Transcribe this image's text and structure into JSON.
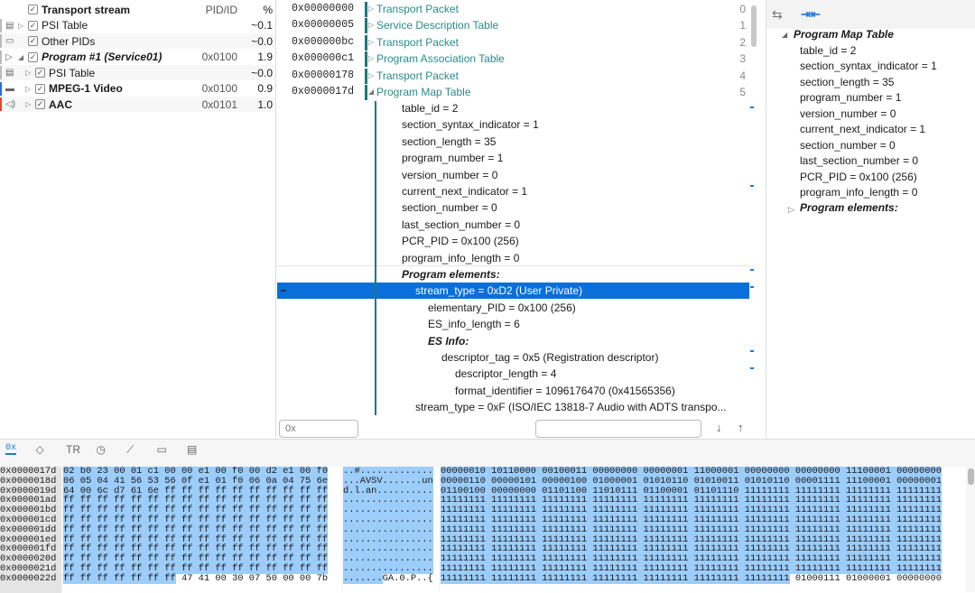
{
  "streams": {
    "header": {
      "label": "Transport stream",
      "pid_col": "PID/ID",
      "pct_col": "%"
    },
    "rows": [
      {
        "label": "PSI Table",
        "pid": "",
        "pct": "~0.1",
        "icon": "table-icon",
        "bold": false,
        "italic": false
      },
      {
        "label": "Other PIDs",
        "pid": "",
        "pct": "~0.0",
        "icon": "other-icon",
        "bold": false,
        "italic": false
      },
      {
        "label": "Program #1 (Service01)",
        "pid": "0x0100",
        "pct": "1.9",
        "icon": "program-icon",
        "bold": true,
        "italic": true
      },
      {
        "label": "PSI Table",
        "pid": "",
        "pct": "~0.0",
        "icon": "table-icon",
        "bold": false,
        "italic": false
      },
      {
        "label": "MPEG-1 Video",
        "pid": "0x0100",
        "pct": "0.9",
        "icon": "video-icon",
        "bold": true,
        "italic": false,
        "color": "#2a6be0"
      },
      {
        "label": "AAC",
        "pid": "0x0101",
        "pct": "1.0",
        "icon": "audio-icon",
        "bold": true,
        "italic": false,
        "color": "#e8452c"
      }
    ]
  },
  "packets": [
    {
      "addr": "0x00000000",
      "label": "Transport Packet",
      "index": "0"
    },
    {
      "addr": "0x00000005",
      "label": "Service Description Table",
      "index": "1"
    },
    {
      "addr": "0x000000bc",
      "label": "Transport Packet",
      "index": "2"
    },
    {
      "addr": "0x000000c1",
      "label": "Program Association Table",
      "index": "3"
    },
    {
      "addr": "0x00000178",
      "label": "Transport Packet",
      "index": "4"
    },
    {
      "addr": "0x0000017d",
      "label": "Program Map Table",
      "index": "5"
    }
  ],
  "pmt_fields": [
    {
      "text": "table_id = 2",
      "level": 0
    },
    {
      "text": "section_syntax_indicator = 1",
      "level": 0
    },
    {
      "text": "section_length = 35",
      "level": 0
    },
    {
      "text": "program_number = 1",
      "level": 0
    },
    {
      "text": "version_number = 0",
      "level": 0
    },
    {
      "text": "current_next_indicator = 1",
      "level": 0
    },
    {
      "text": "section_number = 0",
      "level": 0
    },
    {
      "text": "last_section_number = 0",
      "level": 0
    },
    {
      "text": "PCR_PID = 0x100 (256)",
      "level": 0
    },
    {
      "text": "program_info_length = 0",
      "level": 0
    },
    {
      "text": "Program elements:",
      "level": 0,
      "heading": true
    },
    {
      "text": "stream_type = 0xD2 (User Private)",
      "level": 1,
      "selected": true
    },
    {
      "text": "elementary_PID = 0x100 (256)",
      "level": 2
    },
    {
      "text": "ES_info_length = 6",
      "level": 2
    },
    {
      "text": "ES Info:",
      "level": 2,
      "heading": true
    },
    {
      "text": "descriptor_tag = 0x5 (Registration descriptor)",
      "level": 3
    },
    {
      "text": "descriptor_length = 4",
      "level": 4
    },
    {
      "text": "format_identifier = 1096176470 (0x41565356)",
      "level": 4
    },
    {
      "text": "stream_type = 0xF (ISO/IEC 13818-7 Audio with ADTS transpo...",
      "level": 1
    }
  ],
  "search": {
    "offset_placeholder": "0x",
    "text_value": "",
    "down": "↓",
    "up": "↑"
  },
  "details": {
    "title": "Program Map Table",
    "fields": [
      "table_id  =  2",
      "section_syntax_indicator  =  1",
      "section_length  =  35",
      "program_number  =  1",
      "version_number  =  0",
      "current_next_indicator  =  1",
      "section_number  =  0",
      "last_section_number  =  0",
      "PCR_PID  =  0x100 (256)",
      "program_info_length  =  0"
    ],
    "child": "Program elements:"
  },
  "bottom_tabs": [
    "hex-icon",
    "diamond-icon",
    "text-icon",
    "clock-icon",
    "chart-icon",
    "comment-icon",
    "table-icon"
  ],
  "hex_rows": [
    {
      "addr": "0x0000017d",
      "hex_sel": "02 b0 23 00 01 c1 00 00 e1 00 f0 00 d2 e1 00 f0",
      "hex_rest": "",
      "asc_sel": "..#.............",
      "asc_rest": "",
      "bin_sel": "00000010 10110000 00100011 00000000 00000001 11000001 00000000 00000000 11100001 00000000",
      "bin_rest": ""
    },
    {
      "addr": "0x0000018d",
      "hex_sel": "06 05 04 41 56 53 56 0f e1 01 f0 06 0a 04 75 6e",
      "hex_rest": "",
      "asc_sel": "...AVSV.......un",
      "asc_rest": "",
      "bin_sel": "00000110 00000101 00000100 01000001 01010110 01010011 01010110 00001111 11100001 00000001",
      "bin_rest": ""
    },
    {
      "addr": "0x0000019d",
      "hex_sel": "64 00 6c d7 61 6e ff ff ff ff ff ff ff ff ff ff",
      "hex_rest": "",
      "asc_sel": "d.l.an..........",
      "asc_rest": "",
      "bin_sel": "01100100 00000000 01101100 11010111 01100001 01101110 11111111 11111111 11111111 11111111",
      "bin_rest": ""
    },
    {
      "addr": "0x000001ad",
      "hex_sel": "ff ff ff ff ff ff ff ff ff ff ff ff ff ff ff ff",
      "hex_rest": "",
      "asc_sel": "................",
      "asc_rest": "",
      "bin_sel": "11111111 11111111 11111111 11111111 11111111 11111111 11111111 11111111 11111111 11111111",
      "bin_rest": ""
    },
    {
      "addr": "0x000001bd",
      "hex_sel": "ff ff ff ff ff ff ff ff ff ff ff ff ff ff ff ff",
      "hex_rest": "",
      "asc_sel": "................",
      "asc_rest": "",
      "bin_sel": "11111111 11111111 11111111 11111111 11111111 11111111 11111111 11111111 11111111 11111111",
      "bin_rest": ""
    },
    {
      "addr": "0x000001cd",
      "hex_sel": "ff ff ff ff ff ff ff ff ff ff ff ff ff ff ff ff",
      "hex_rest": "",
      "asc_sel": "................",
      "asc_rest": "",
      "bin_sel": "11111111 11111111 11111111 11111111 11111111 11111111 11111111 11111111 11111111 11111111",
      "bin_rest": ""
    },
    {
      "addr": "0x000001dd",
      "hex_sel": "ff ff ff ff ff ff ff ff ff ff ff ff ff ff ff ff",
      "hex_rest": "",
      "asc_sel": "................",
      "asc_rest": "",
      "bin_sel": "11111111 11111111 11111111 11111111 11111111 11111111 11111111 11111111 11111111 11111111",
      "bin_rest": ""
    },
    {
      "addr": "0x000001ed",
      "hex_sel": "ff ff ff ff ff ff ff ff ff ff ff ff ff ff ff ff",
      "hex_rest": "",
      "asc_sel": "................",
      "asc_rest": "",
      "bin_sel": "11111111 11111111 11111111 11111111 11111111 11111111 11111111 11111111 11111111 11111111",
      "bin_rest": ""
    },
    {
      "addr": "0x000001fd",
      "hex_sel": "ff ff ff ff ff ff ff ff ff ff ff ff ff ff ff ff",
      "hex_rest": "",
      "asc_sel": "................",
      "asc_rest": "",
      "bin_sel": "11111111 11111111 11111111 11111111 11111111 11111111 11111111 11111111 11111111 11111111",
      "bin_rest": ""
    },
    {
      "addr": "0x0000020d",
      "hex_sel": "ff ff ff ff ff ff ff ff ff ff ff ff ff ff ff ff",
      "hex_rest": "",
      "asc_sel": "................",
      "asc_rest": "",
      "bin_sel": "11111111 11111111 11111111 11111111 11111111 11111111 11111111 11111111 11111111 11111111",
      "bin_rest": ""
    },
    {
      "addr": "0x0000021d",
      "hex_sel": "ff ff ff ff ff ff ff ff ff ff ff ff ff ff ff ff",
      "hex_rest": "",
      "asc_sel": "................",
      "asc_rest": "",
      "bin_sel": "11111111 11111111 11111111 11111111 11111111 11111111 11111111 11111111 11111111 11111111",
      "bin_rest": ""
    },
    {
      "addr": "0x0000022d",
      "hex_sel": "ff ff ff ff ff ff ff",
      "hex_rest": " 47 41 00 30 07 50 00 00 7b",
      "asc_sel": ".......",
      "asc_rest": "GA.0.P..{",
      "bin_sel": "11111111 11111111 11111111 11111111 11111111 11111111 11111111",
      "bin_rest": " 01000111 01000001 00000000"
    }
  ],
  "colors": {
    "accent": "#0a6fd8",
    "teal": "#1b7a78",
    "link": "#2a8a8a",
    "hex_selection": "#9ccdfb"
  }
}
